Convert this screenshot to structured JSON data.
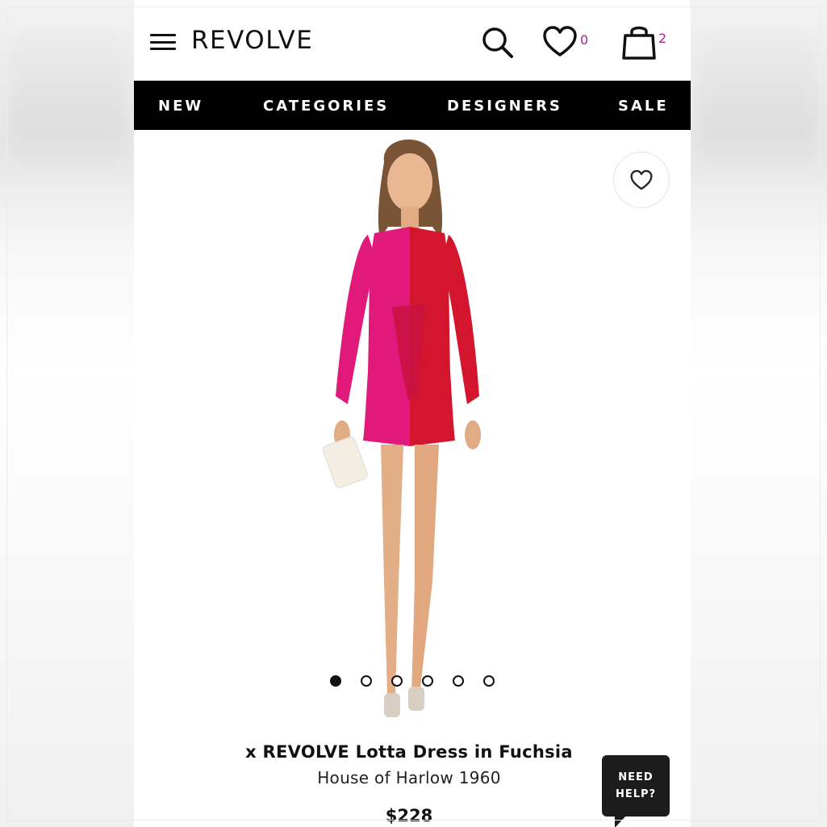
{
  "header": {
    "logo": "REVOLVE",
    "wishlist_count": "0",
    "bag_count": "2",
    "icons": [
      "menu-icon",
      "search-icon",
      "heart-icon",
      "shopping-bag-icon"
    ]
  },
  "nav": {
    "items": [
      "NEW",
      "CATEGORIES",
      "DESIGNERS",
      "SALE"
    ]
  },
  "product": {
    "title": "x REVOLVE Lotta Dress in Fuchsia",
    "brand": "House of Harlow 1960",
    "price": "$228",
    "image_count": 6,
    "active_image": 1,
    "colors": {
      "fuchsia": "#e0197a",
      "red": "#d3152d"
    }
  },
  "help": {
    "line1": "NEED",
    "line2": "HELP?"
  },
  "theme": {
    "accent_count_color": "#b2228f",
    "nav_bg": "#000000"
  }
}
